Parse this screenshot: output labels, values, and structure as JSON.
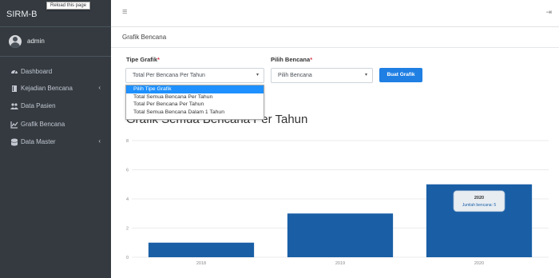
{
  "app": {
    "brand": "SIRM-B",
    "reload_tooltip": "Reload this page",
    "user_name": "admin"
  },
  "sidebar": {
    "items": [
      {
        "label": "Dashboard",
        "icon": "tachometer-icon",
        "has_caret": false
      },
      {
        "label": "Kejadian Bencana",
        "icon": "book-icon",
        "has_caret": true
      },
      {
        "label": "Data Pasien",
        "icon": "users-icon",
        "has_caret": false
      },
      {
        "label": "Grafik Bencana",
        "icon": "chart-line-icon",
        "has_caret": false
      },
      {
        "label": "Data Master",
        "icon": "database-icon",
        "has_caret": true
      }
    ],
    "caret_glyph": "‹"
  },
  "header": {
    "menu_glyph": "≡",
    "logout_glyph": "⇥",
    "page_title": "Grafik Bencana"
  },
  "form": {
    "chart_type_label": "Tipe Grafik",
    "chart_type_value": "Total Per Bencana Per Tahun",
    "disaster_label": "Pilih Bencana",
    "disaster_value": "Pilih Bencana",
    "required_mark": "*",
    "submit_label": "Buat Grafik",
    "arrow_glyph": "▾",
    "options": [
      "Pilih Tipe Grafik",
      "Total Semua Bencana Per Tahun",
      "Total Per Bencana Per Tahun",
      "Total Semua Bencana Dalam 1 Tahun"
    ],
    "selected_option_index": 0
  },
  "chart_title": "Grafik Semua Bencana Per Tahun",
  "colors": {
    "sidebar": "#343a40",
    "bar": "#1a5fa6",
    "button": "#1f7fe3",
    "highlight": "#1e90ff"
  },
  "chart_data": {
    "type": "bar",
    "categories": [
      "2018",
      "2019",
      "2020"
    ],
    "series": [
      {
        "name": "Jumlah bencana",
        "values": [
          1,
          3,
          5
        ]
      }
    ],
    "ylim": [
      0,
      8
    ],
    "yticks": [
      "0",
      "2",
      "4",
      "6",
      "8"
    ],
    "grid": true,
    "tooltip": {
      "category": "2020",
      "text": "Jumlah bencana: 5"
    }
  }
}
